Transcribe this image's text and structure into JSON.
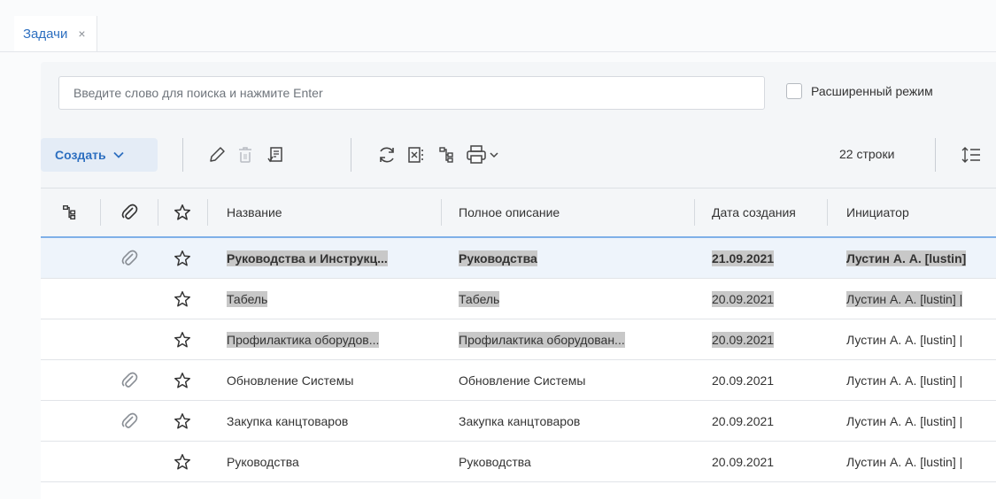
{
  "tabs": [
    {
      "label": "Задачи",
      "close": "×"
    }
  ],
  "search": {
    "placeholder": "Введите слово для поиска и нажмите Enter",
    "value": ""
  },
  "advanced_mode": {
    "label": "Расширенный режим",
    "checked": false
  },
  "toolbar": {
    "create_label": "Создать",
    "create_icon": "chevron-down-icon",
    "icons": [
      "edit-icon",
      "delete-icon",
      "approve-doc-icon",
      "refresh-icon",
      "excel-export-icon",
      "hierarchy-icon",
      "print-icon",
      "chevron-down-icon",
      "row-height-icon"
    ],
    "rows_count": "22 строки"
  },
  "table": {
    "columns": [
      "hierarchy-icon",
      "attachment-icon",
      "star-icon",
      "Название",
      "Полное описание",
      "Дата создания",
      "Инициатор"
    ],
    "rows": [
      {
        "attachment": true,
        "name": "Руководства и Инструкц...",
        "description": "Руководства",
        "date": "21.09.2021",
        "initiator": "Лустин А. А. [lustin]",
        "bold": true,
        "selected": true,
        "highlight_initiator": true
      },
      {
        "attachment": false,
        "name": "Табель",
        "description": "Табель",
        "date": "20.09.2021",
        "initiator": "Лустин А. А. [lustin] |",
        "bold": false,
        "selected": false,
        "highlight_initiator": true
      },
      {
        "attachment": false,
        "name": "Профилактика оборудов...",
        "description": "Профилактика оборудован...",
        "date": "20.09.2021",
        "initiator": "Лустин А. А. [lustin] |",
        "bold": false,
        "selected": false,
        "highlight_initiator": false,
        "highlight_partial": true
      },
      {
        "attachment": true,
        "name": "Обновление Системы",
        "description": "Обновление Системы",
        "date": "20.09.2021",
        "initiator": "Лустин А. А. [lustin] |",
        "bold": false,
        "selected": false,
        "highlight_initiator": false
      },
      {
        "attachment": true,
        "name": "Закупка канцтоваров",
        "description": "Закупка канцтоваров",
        "date": "20.09.2021",
        "initiator": "Лустин А. А. [lustin] |",
        "bold": false,
        "selected": false,
        "highlight_initiator": false
      },
      {
        "attachment": false,
        "name": "Руководства",
        "description": "Руководства",
        "date": "20.09.2021",
        "initiator": "Лустин А. А. [lustin] |",
        "bold": false,
        "selected": false,
        "highlight_initiator": false
      }
    ]
  },
  "colors": {
    "accent": "#2d6fc0",
    "highlight": "#c8c8c8",
    "selected_row": "#eef4fb",
    "header_underline": "#7fb0e8"
  }
}
